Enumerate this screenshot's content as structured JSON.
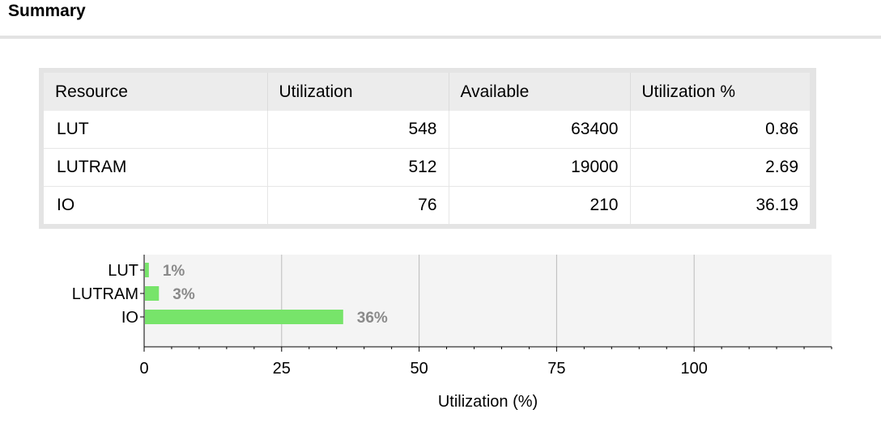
{
  "header": {
    "title": "Summary"
  },
  "table": {
    "columns": [
      "Resource",
      "Utilization",
      "Available",
      "Utilization %"
    ],
    "rows": [
      [
        "LUT",
        "548",
        "63400",
        "0.86"
      ],
      [
        "LUTRAM",
        "512",
        "19000",
        "2.69"
      ],
      [
        "IO",
        "76",
        "210",
        "36.19"
      ]
    ]
  },
  "colors": {
    "bar": "#77e46a",
    "plot_bg": "#f4f4f4",
    "grid": "#bbbbbb",
    "data_label": "#8a8a8a"
  },
  "chart_data": {
    "type": "bar",
    "orientation": "horizontal",
    "categories": [
      "LUT",
      "LUTRAM",
      "IO"
    ],
    "values": [
      0.86,
      2.69,
      36.19
    ],
    "data_labels": [
      "1%",
      "3%",
      "36%"
    ],
    "xlabel": "Utilization (%)",
    "xlim": [
      0,
      125
    ],
    "x_ticks": [
      0,
      25,
      50,
      75,
      100
    ],
    "x_tick_labels": [
      "0",
      "25",
      "50",
      "75",
      "100"
    ],
    "grid": "vertical",
    "legend": "none"
  }
}
